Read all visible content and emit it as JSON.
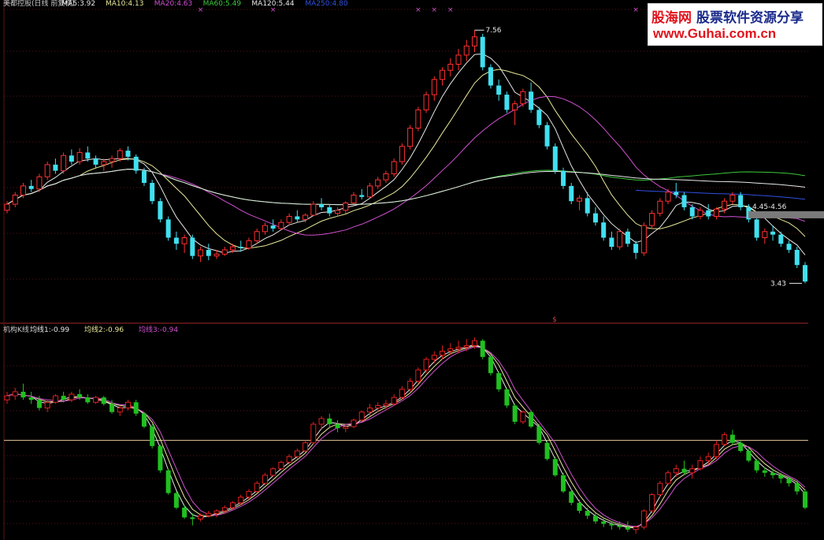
{
  "top_legend": [
    {
      "text": "美都控股(日线 前复权)",
      "color": "#c8c8c8"
    },
    {
      "text": "MA5:3.92",
      "color": "#e8e8e8"
    },
    {
      "text": "MA10:4.13",
      "color": "#e8e89a"
    },
    {
      "text": "MA20:4.63",
      "color": "#d050d0"
    },
    {
      "text": "MA60:5.49",
      "color": "#3cc83c"
    },
    {
      "text": "MA120:5.44",
      "color": "#e8e8e8"
    },
    {
      "text": "MA250:4.80",
      "color": "#3050e0"
    }
  ],
  "bottom_legend": [
    {
      "text": "机构K线",
      "color": "#c8c8c8"
    },
    {
      "text": "均线1:-0.99",
      "color": "#e8e8e8"
    },
    {
      "text": "均线2:-0.96",
      "color": "#e8e89a"
    },
    {
      "text": "均线3:-0.94",
      "color": "#d050d0"
    }
  ],
  "watermark": {
    "brand": "股海网",
    "tagline": "股票软件资源分享",
    "url": "www.Guhai.com.cn"
  },
  "colors": {
    "up": "#ff3030",
    "down": "#40e0f0",
    "ind_up": "#e02020",
    "ind_down": "#20c020",
    "divider": "#a0282a"
  },
  "chart_data": [
    {
      "type": "candlestick",
      "title": "美都控股(日线 前复权)",
      "ylim": [
        2.9,
        7.9
      ],
      "annotations": {
        "high_label": "7.56",
        "low_label": "3.43",
        "range_box": "4.45-4.56",
        "marker": "$"
      },
      "candles": [
        [
          4.6,
          4.75,
          4.55,
          4.7
        ],
        [
          4.7,
          4.9,
          4.65,
          4.85
        ],
        [
          4.85,
          5.05,
          4.8,
          5.0
        ],
        [
          5.0,
          5.1,
          4.9,
          4.95
        ],
        [
          4.95,
          5.2,
          4.9,
          5.15
        ],
        [
          5.15,
          5.4,
          5.1,
          5.35
        ],
        [
          5.35,
          5.45,
          5.2,
          5.25
        ],
        [
          5.25,
          5.55,
          5.2,
          5.5
        ],
        [
          5.5,
          5.6,
          5.35,
          5.4
        ],
        [
          5.4,
          5.62,
          5.35,
          5.55
        ],
        [
          5.55,
          5.65,
          5.4,
          5.45
        ],
        [
          5.45,
          5.5,
          5.3,
          5.35
        ],
        [
          5.35,
          5.45,
          5.25,
          5.4
        ],
        [
          5.4,
          5.5,
          5.3,
          5.45
        ],
        [
          5.45,
          5.62,
          5.4,
          5.58
        ],
        [
          5.58,
          5.65,
          5.42,
          5.48
        ],
        [
          5.48,
          5.52,
          5.2,
          5.25
        ],
        [
          5.25,
          5.3,
          5.0,
          5.05
        ],
        [
          5.05,
          5.1,
          4.7,
          4.75
        ],
        [
          4.75,
          4.8,
          4.4,
          4.45
        ],
        [
          4.45,
          4.5,
          4.1,
          4.15
        ],
        [
          4.15,
          4.25,
          3.95,
          4.05
        ],
        [
          4.05,
          4.2,
          3.9,
          4.15
        ],
        [
          4.15,
          4.2,
          3.8,
          3.85
        ],
        [
          3.85,
          4.0,
          3.75,
          3.95
        ],
        [
          3.95,
          4.05,
          3.78,
          3.85
        ],
        [
          3.85,
          3.95,
          3.8,
          3.88
        ],
        [
          3.88,
          4.0,
          3.85,
          3.95
        ],
        [
          3.95,
          4.05,
          3.9,
          4.0
        ],
        [
          4.0,
          4.1,
          3.92,
          3.98
        ],
        [
          3.98,
          4.15,
          3.95,
          4.1
        ],
        [
          4.1,
          4.3,
          4.05,
          4.25
        ],
        [
          4.25,
          4.4,
          4.2,
          4.35
        ],
        [
          4.35,
          4.45,
          4.25,
          4.3
        ],
        [
          4.3,
          4.45,
          4.28,
          4.4
        ],
        [
          4.4,
          4.55,
          4.35,
          4.5
        ],
        [
          4.5,
          4.6,
          4.4,
          4.45
        ],
        [
          4.45,
          4.55,
          4.4,
          4.52
        ],
        [
          4.52,
          4.75,
          4.5,
          4.7
        ],
        [
          4.7,
          4.8,
          4.6,
          4.65
        ],
        [
          4.65,
          4.7,
          4.5,
          4.55
        ],
        [
          4.55,
          4.65,
          4.5,
          4.6
        ],
        [
          4.6,
          4.75,
          4.55,
          4.72
        ],
        [
          4.72,
          4.9,
          4.7,
          4.85
        ],
        [
          4.85,
          4.95,
          4.78,
          4.82
        ],
        [
          4.82,
          5.05,
          4.8,
          5.0
        ],
        [
          5.0,
          5.15,
          4.95,
          5.1
        ],
        [
          5.1,
          5.25,
          5.05,
          5.2
        ],
        [
          5.2,
          5.45,
          5.15,
          5.4
        ],
        [
          5.4,
          5.7,
          5.35,
          5.65
        ],
        [
          5.65,
          6.0,
          5.6,
          5.95
        ],
        [
          5.95,
          6.3,
          5.9,
          6.25
        ],
        [
          6.25,
          6.55,
          6.2,
          6.5
        ],
        [
          6.5,
          6.8,
          6.4,
          6.75
        ],
        [
          6.75,
          6.95,
          6.65,
          6.9
        ],
        [
          6.9,
          7.1,
          6.8,
          7.0
        ],
        [
          7.0,
          7.25,
          6.9,
          7.15
        ],
        [
          7.15,
          7.4,
          7.05,
          7.3
        ],
        [
          7.3,
          7.56,
          7.2,
          7.45
        ],
        [
          7.45,
          7.5,
          6.9,
          6.95
        ],
        [
          6.95,
          7.0,
          6.6,
          6.65
        ],
        [
          6.65,
          6.75,
          6.4,
          6.5
        ],
        [
          6.5,
          6.55,
          6.2,
          6.25
        ],
        [
          6.25,
          6.4,
          6.0,
          6.35
        ],
        [
          6.35,
          6.6,
          6.3,
          6.55
        ],
        [
          6.55,
          6.7,
          6.2,
          6.25
        ],
        [
          6.25,
          6.3,
          5.95,
          6.0
        ],
        [
          6.0,
          6.05,
          5.6,
          5.65
        ],
        [
          5.65,
          5.7,
          5.2,
          5.25
        ],
        [
          5.25,
          5.3,
          4.95,
          5.0
        ],
        [
          5.0,
          5.05,
          4.7,
          4.75
        ],
        [
          4.75,
          4.85,
          4.6,
          4.8
        ],
        [
          4.8,
          4.9,
          4.5,
          4.55
        ],
        [
          4.55,
          4.65,
          4.35,
          4.4
        ],
        [
          4.4,
          4.5,
          4.1,
          4.15
        ],
        [
          4.15,
          4.25,
          3.95,
          4.0
        ],
        [
          4.0,
          4.3,
          3.95,
          4.25
        ],
        [
          4.25,
          4.3,
          4.0,
          4.05
        ],
        [
          4.05,
          4.1,
          3.8,
          3.9
        ],
        [
          3.9,
          4.4,
          3.85,
          4.35
        ],
        [
          4.35,
          4.6,
          4.3,
          4.55
        ],
        [
          4.55,
          4.8,
          4.5,
          4.75
        ],
        [
          4.75,
          4.95,
          4.7,
          4.9
        ],
        [
          4.9,
          5.05,
          4.8,
          4.85
        ],
        [
          4.85,
          4.9,
          4.6,
          4.65
        ],
        [
          4.65,
          4.7,
          4.45,
          4.5
        ],
        [
          4.5,
          4.65,
          4.45,
          4.6
        ],
        [
          4.6,
          4.7,
          4.45,
          4.5
        ],
        [
          4.5,
          4.65,
          4.45,
          4.62
        ],
        [
          4.62,
          4.8,
          4.55,
          4.75
        ],
        [
          4.75,
          4.9,
          4.7,
          4.85
        ],
        [
          4.85,
          4.9,
          4.6,
          4.65
        ],
        [
          4.65,
          4.7,
          4.4,
          4.45
        ],
        [
          4.45,
          4.5,
          4.1,
          4.15
        ],
        [
          4.15,
          4.3,
          4.05,
          4.25
        ],
        [
          4.25,
          4.35,
          4.1,
          4.2
        ],
        [
          4.2,
          4.25,
          4.0,
          4.05
        ],
        [
          4.05,
          4.1,
          3.9,
          3.95
        ],
        [
          3.95,
          4.0,
          3.65,
          3.7
        ],
        [
          3.7,
          3.75,
          3.4,
          3.43
        ]
      ]
    },
    {
      "type": "candlestick",
      "title": "机构K线",
      "ylim": [
        -1.25,
        1.25
      ],
      "reference_line": -0.05,
      "candles": [
        [
          0.45,
          0.55,
          0.4,
          0.5
        ],
        [
          0.5,
          0.6,
          0.45,
          0.55
        ],
        [
          0.55,
          0.65,
          0.45,
          0.48
        ],
        [
          0.48,
          0.55,
          0.4,
          0.45
        ],
        [
          0.45,
          0.5,
          0.32,
          0.35
        ],
        [
          0.35,
          0.45,
          0.3,
          0.42
        ],
        [
          0.42,
          0.52,
          0.4,
          0.5
        ],
        [
          0.5,
          0.55,
          0.42,
          0.45
        ],
        [
          0.45,
          0.55,
          0.42,
          0.52
        ],
        [
          0.52,
          0.58,
          0.45,
          0.48
        ],
        [
          0.48,
          0.52,
          0.4,
          0.42
        ],
        [
          0.42,
          0.5,
          0.4,
          0.48
        ],
        [
          0.48,
          0.5,
          0.38,
          0.4
        ],
        [
          0.4,
          0.45,
          0.28,
          0.3
        ],
        [
          0.3,
          0.38,
          0.25,
          0.35
        ],
        [
          0.35,
          0.45,
          0.32,
          0.42
        ],
        [
          0.42,
          0.45,
          0.25,
          0.28
        ],
        [
          0.28,
          0.3,
          0.1,
          0.12
        ],
        [
          0.12,
          0.15,
          -0.15,
          -0.12
        ],
        [
          -0.12,
          -0.1,
          -0.45,
          -0.42
        ],
        [
          -0.42,
          -0.4,
          -0.72,
          -0.7
        ],
        [
          -0.7,
          -0.68,
          -0.9,
          -0.88
        ],
        [
          -0.88,
          -0.85,
          -1.02,
          -1.0
        ],
        [
          -1.0,
          -0.95,
          -1.1,
          -1.02
        ],
        [
          -1.02,
          -0.95,
          -1.05,
          -0.98
        ],
        [
          -0.98,
          -0.92,
          -1.0,
          -0.95
        ],
        [
          -0.95,
          -0.9,
          -1.0,
          -0.92
        ],
        [
          -0.92,
          -0.85,
          -0.95,
          -0.88
        ],
        [
          -0.88,
          -0.8,
          -0.9,
          -0.82
        ],
        [
          -0.82,
          -0.72,
          -0.85,
          -0.75
        ],
        [
          -0.75,
          -0.65,
          -0.78,
          -0.68
        ],
        [
          -0.68,
          -0.55,
          -0.7,
          -0.58
        ],
        [
          -0.58,
          -0.45,
          -0.6,
          -0.48
        ],
        [
          -0.48,
          -0.38,
          -0.5,
          -0.4
        ],
        [
          -0.4,
          -0.3,
          -0.42,
          -0.32
        ],
        [
          -0.32,
          -0.22,
          -0.35,
          -0.25
        ],
        [
          -0.25,
          -0.15,
          -0.28,
          -0.18
        ],
        [
          -0.18,
          -0.05,
          -0.2,
          -0.08
        ],
        [
          -0.08,
          0.18,
          -0.1,
          0.15
        ],
        [
          0.15,
          0.25,
          0.08,
          0.22
        ],
        [
          0.22,
          0.28,
          0.1,
          0.15
        ],
        [
          0.15,
          0.2,
          0.05,
          0.1
        ],
        [
          0.1,
          0.15,
          0.05,
          0.12
        ],
        [
          0.12,
          0.22,
          0.1,
          0.2
        ],
        [
          0.2,
          0.32,
          0.18,
          0.3
        ],
        [
          0.3,
          0.4,
          0.25,
          0.35
        ],
        [
          0.35,
          0.42,
          0.3,
          0.38
        ],
        [
          0.38,
          0.45,
          0.32,
          0.4
        ],
        [
          0.4,
          0.52,
          0.38,
          0.48
        ],
        [
          0.48,
          0.62,
          0.45,
          0.58
        ],
        [
          0.58,
          0.72,
          0.55,
          0.68
        ],
        [
          0.68,
          0.85,
          0.65,
          0.82
        ],
        [
          0.82,
          0.98,
          0.78,
          0.95
        ],
        [
          0.95,
          1.05,
          0.9,
          1.0
        ],
        [
          1.0,
          1.12,
          0.95,
          1.05
        ],
        [
          1.05,
          1.15,
          1.0,
          1.08
        ],
        [
          1.08,
          1.18,
          1.02,
          1.1
        ],
        [
          1.1,
          1.2,
          1.05,
          1.12
        ],
        [
          1.12,
          1.22,
          1.08,
          1.18
        ],
        [
          1.18,
          1.2,
          0.95,
          0.98
        ],
        [
          0.98,
          1.0,
          0.75,
          0.78
        ],
        [
          0.78,
          0.8,
          0.55,
          0.58
        ],
        [
          0.58,
          0.6,
          0.35,
          0.38
        ],
        [
          0.38,
          0.4,
          0.15,
          0.18
        ],
        [
          0.18,
          0.32,
          0.15,
          0.3
        ],
        [
          0.3,
          0.32,
          0.1,
          0.12
        ],
        [
          0.12,
          0.15,
          -0.1,
          -0.08
        ],
        [
          -0.08,
          -0.05,
          -0.3,
          -0.28
        ],
        [
          -0.28,
          -0.25,
          -0.5,
          -0.48
        ],
        [
          -0.48,
          -0.45,
          -0.7,
          -0.68
        ],
        [
          -0.68,
          -0.65,
          -0.85,
          -0.82
        ],
        [
          -0.82,
          -0.78,
          -0.95,
          -0.92
        ],
        [
          -0.92,
          -0.88,
          -1.02,
          -0.98
        ],
        [
          -0.98,
          -0.95,
          -1.08,
          -1.05
        ],
        [
          -1.05,
          -1.0,
          -1.12,
          -1.08
        ],
        [
          -1.08,
          -1.05,
          -1.15,
          -1.1
        ],
        [
          -1.1,
          -1.05,
          -1.15,
          -1.12
        ],
        [
          -1.12,
          -1.05,
          -1.18,
          -1.15
        ],
        [
          -1.15,
          -1.1,
          -1.2,
          -1.12
        ],
        [
          -1.12,
          -0.9,
          -1.15,
          -0.92
        ],
        [
          -0.92,
          -0.7,
          -0.95,
          -0.72
        ],
        [
          -0.72,
          -0.55,
          -0.75,
          -0.58
        ],
        [
          -0.58,
          -0.42,
          -0.6,
          -0.45
        ],
        [
          -0.45,
          -0.35,
          -0.5,
          -0.4
        ],
        [
          -0.4,
          -0.3,
          -0.48,
          -0.45
        ],
        [
          -0.45,
          -0.35,
          -0.52,
          -0.4
        ],
        [
          -0.4,
          -0.25,
          -0.42,
          -0.3
        ],
        [
          -0.3,
          -0.2,
          -0.35,
          -0.25
        ],
        [
          -0.25,
          -0.05,
          -0.28,
          -0.1
        ],
        [
          -0.1,
          0.05,
          -0.12,
          0.02
        ],
        [
          0.02,
          0.08,
          -0.1,
          -0.08
        ],
        [
          -0.08,
          -0.05,
          -0.2,
          -0.18
        ],
        [
          -0.18,
          -0.15,
          -0.32,
          -0.3
        ],
        [
          -0.3,
          -0.28,
          -0.45,
          -0.42
        ],
        [
          -0.42,
          -0.38,
          -0.5,
          -0.45
        ],
        [
          -0.45,
          -0.4,
          -0.52,
          -0.48
        ],
        [
          -0.48,
          -0.45,
          -0.58,
          -0.52
        ],
        [
          -0.52,
          -0.5,
          -0.62,
          -0.58
        ],
        [
          -0.58,
          -0.55,
          -0.72,
          -0.68
        ],
        [
          -0.68,
          -0.65,
          -0.9,
          -0.88
        ]
      ]
    }
  ]
}
